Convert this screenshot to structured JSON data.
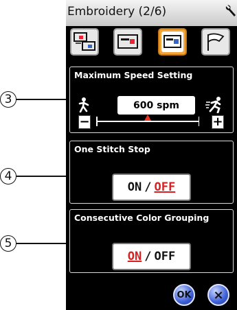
{
  "header": {
    "title": "Embroidery (2/6)",
    "settings_icon": "wrench-icon"
  },
  "tabs": [
    {
      "icon": "machine-multi-icon",
      "active": false
    },
    {
      "icon": "machine-red-icon",
      "active": false
    },
    {
      "icon": "machine-blue-icon",
      "active": true
    },
    {
      "icon": "flag-icon",
      "active": false
    }
  ],
  "callouts": [
    "3",
    "4",
    "5"
  ],
  "speed": {
    "title": "Maximum Speed Setting",
    "value": "600 spm",
    "minus_label": "−",
    "plus_label": "+",
    "slow_icon": "walking-person-icon",
    "fast_icon": "running-person-icon",
    "slider_level": 0.5
  },
  "one_stitch_stop": {
    "title": "One Stitch Stop",
    "on_label": "ON",
    "separator": "/",
    "off_label": "OFF",
    "selected": "OFF"
  },
  "color_grouping": {
    "title": "Consecutive Color Grouping",
    "on_label": "ON",
    "separator": "/",
    "off_label": "OFF",
    "selected": "ON"
  },
  "footer": {
    "ok_label": "OK",
    "close_label": "×"
  },
  "colors": {
    "accent_tab": "#f2a33a",
    "selected_text": "#d91f1f",
    "button_blue": "#3f5fd7"
  }
}
